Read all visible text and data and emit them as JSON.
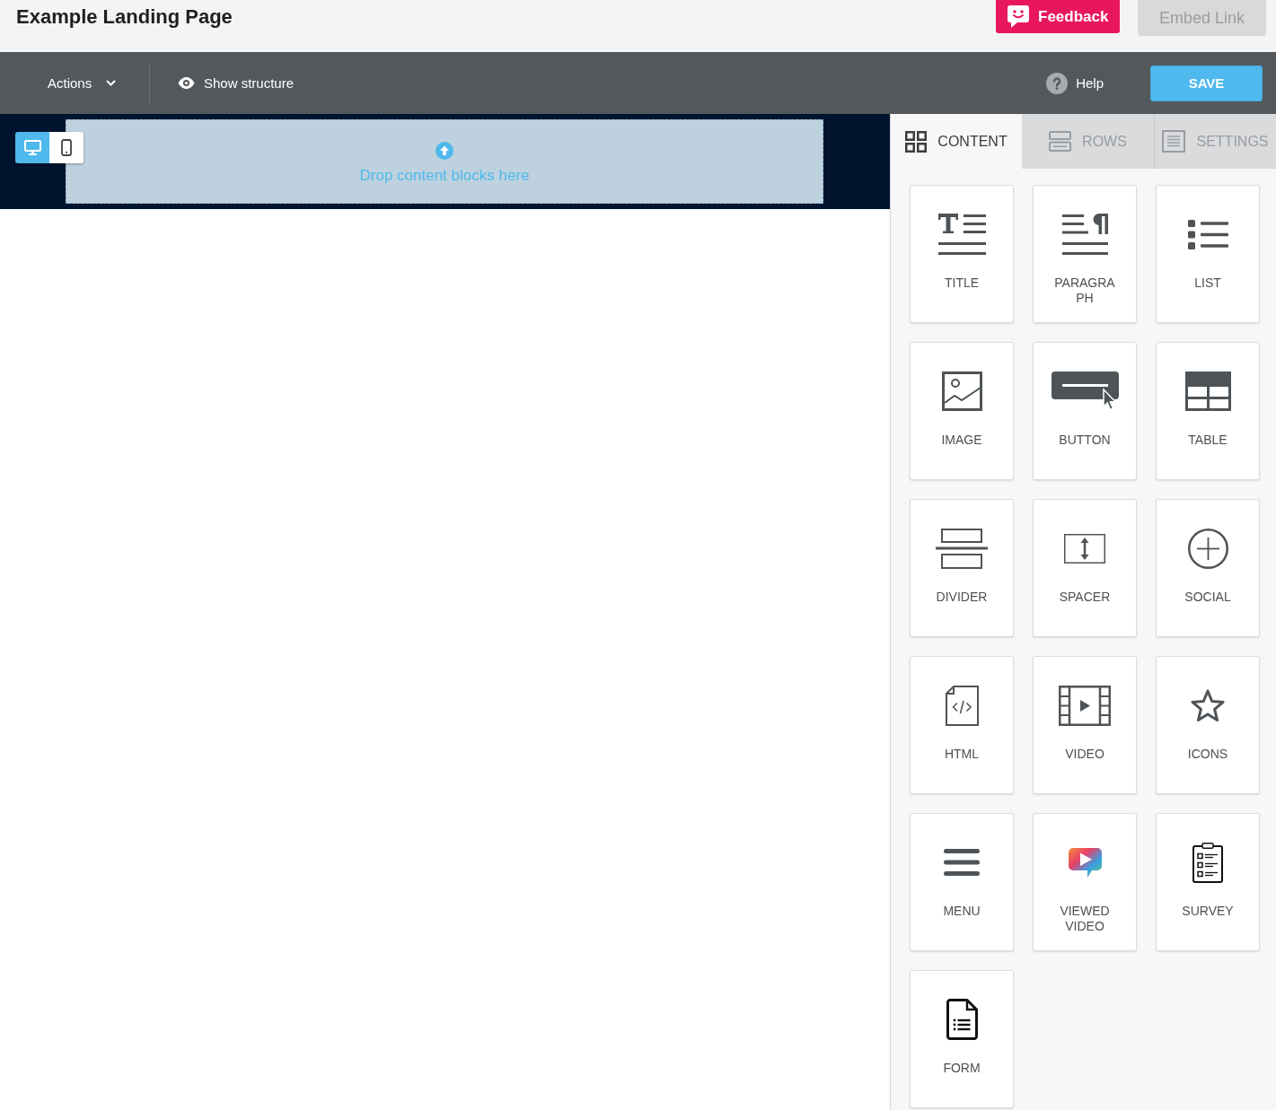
{
  "header": {
    "title": "Example Landing Page",
    "feedback_button": "Feedback",
    "embed_link_button": {
      "label": "Embed Link",
      "disabled": true
    }
  },
  "toolbar": {
    "actions_menu": "Actions",
    "show_structure": "Show structure",
    "help": "Help",
    "save_button": "SAVE"
  },
  "canvas": {
    "view_toggle": [
      {
        "selected": true
      },
      {
        "selected": false
      }
    ],
    "drop_zone": "Drop content blocks here"
  },
  "sidebar": {
    "tabs": [
      {
        "label": "CONTENT",
        "selected": true
      },
      {
        "label": "ROWS",
        "selected": false
      },
      {
        "label": "SETTINGS",
        "selected": false
      }
    ],
    "blocks": [
      {
        "label": "TITLE"
      },
      {
        "label": "PARAGRAPH"
      },
      {
        "label": "LIST"
      },
      {
        "label": "IMAGE"
      },
      {
        "label": "BUTTON"
      },
      {
        "label": "TABLE"
      },
      {
        "label": "DIVIDER"
      },
      {
        "label": "SPACER"
      },
      {
        "label": "SOCIAL"
      },
      {
        "label": "HTML"
      },
      {
        "label": "VIDEO"
      },
      {
        "label": "ICONS"
      },
      {
        "label": "MENU"
      },
      {
        "label": "VIEWED VIDEO"
      },
      {
        "label": "SURVEY"
      },
      {
        "label": "FORM"
      }
    ]
  }
}
